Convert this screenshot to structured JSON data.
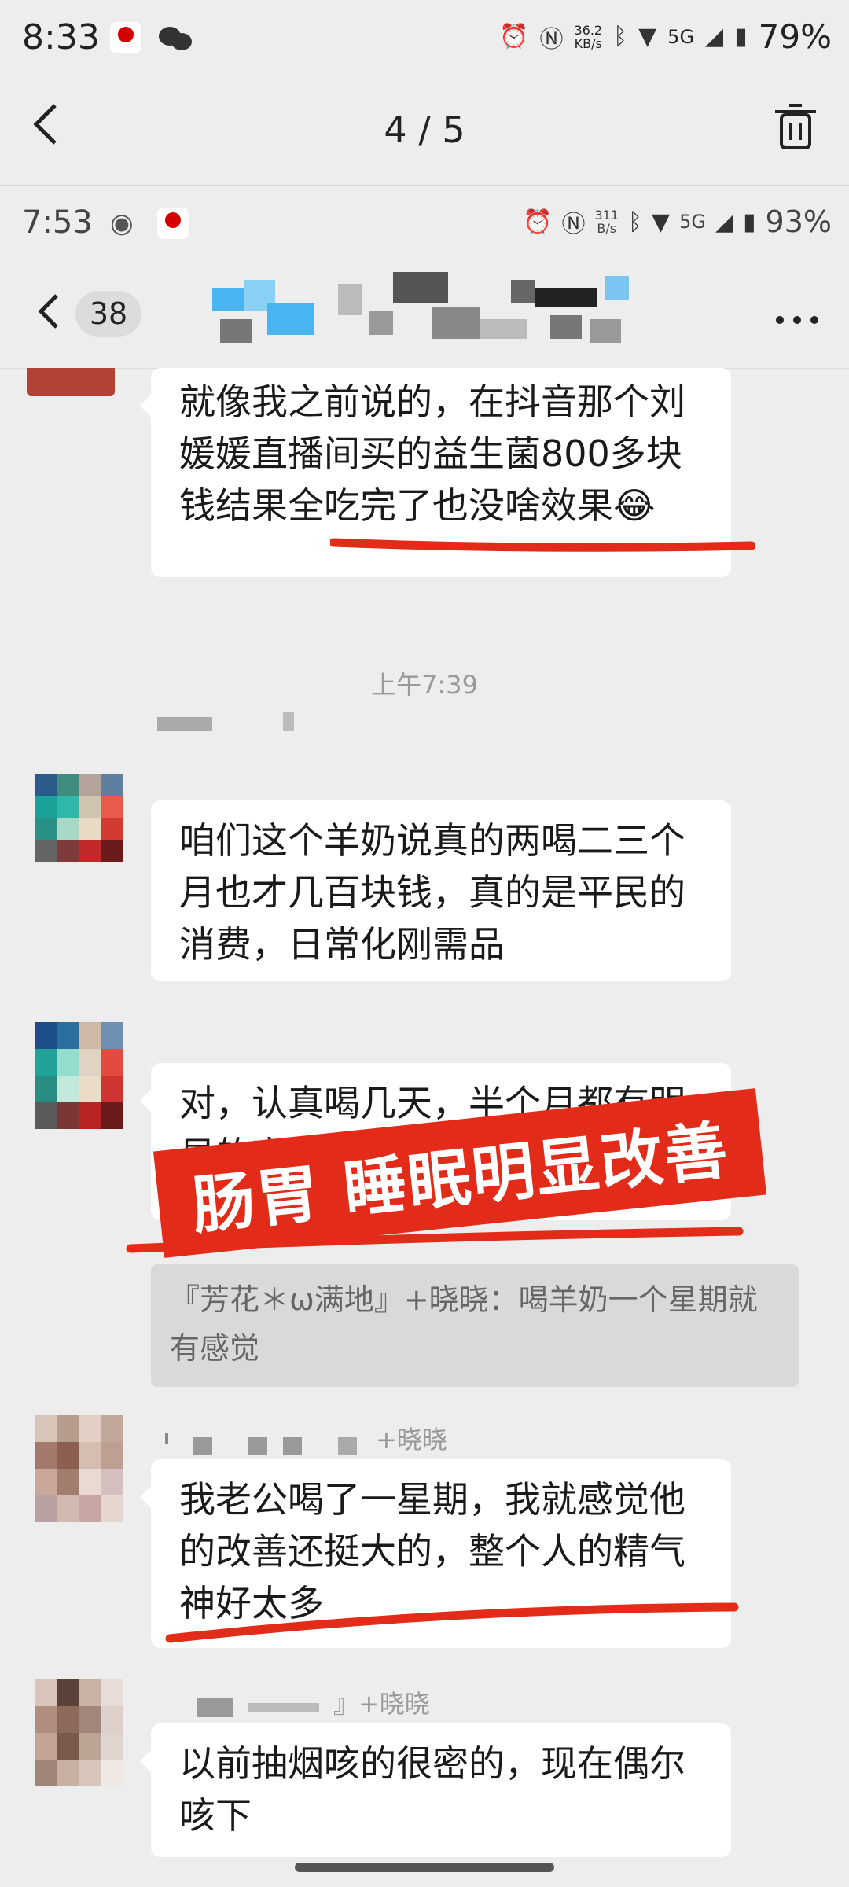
{
  "outer_status": {
    "time": "8:33",
    "net_speed": "36.2\nKB/s",
    "network": "5G",
    "battery": "79%"
  },
  "viewer": {
    "back_icon": "chevron-left-icon",
    "page_indicator": "4 / 5",
    "delete_icon": "trash-icon"
  },
  "screenshot": {
    "status": {
      "time": "7:53",
      "net_speed": "311\nB/s",
      "network": "5G",
      "battery": "93%"
    },
    "chat_header": {
      "back_icon": "chevron-left-icon",
      "unread_count": "38",
      "more_icon": "more-icon"
    },
    "messages": [
      {
        "type": "text",
        "text": "就像我之前说的，在抖音那个刘媛媛直播间买的益生菌800多块钱结果全吃完了也没啥效果😂"
      },
      {
        "type": "time",
        "text": "上午7:39"
      },
      {
        "type": "text",
        "text": "咱们这个羊奶说真的两喝二三个月也才几百块钱，真的是平民的消费，日常化刚需品"
      },
      {
        "type": "text",
        "text": "对，认真喝几天，半个月都有明显的变化，特别是肠胃，睡眠方面的，很快"
      },
      {
        "type": "quote",
        "text": "『芳花＊ω满地』+晓晓：喝羊奶一个星期就有感觉"
      },
      {
        "type": "text",
        "nickname": "+晓晓",
        "text": "我老公喝了一星期，我就感觉他的改善还挺大的，整个人的精气神好太多"
      },
      {
        "type": "text",
        "nickname": "』+晓晓",
        "text": "以前抽烟咳的很密的，现在偶尔咳下"
      }
    ],
    "banner": "肠胃 睡眠明显改善",
    "colors": {
      "highlight": "#e32b19",
      "background": "#ededed",
      "bubble": "#ffffff"
    }
  }
}
